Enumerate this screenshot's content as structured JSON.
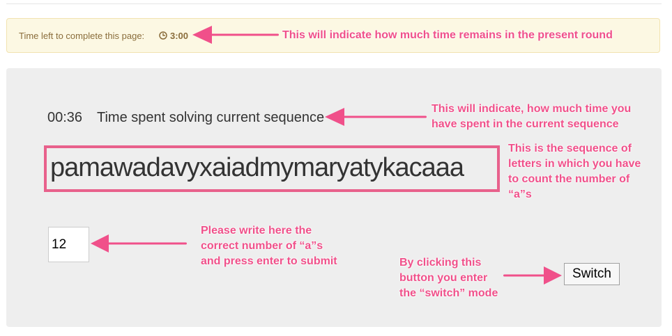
{
  "timer_banner": {
    "label": "Time left to complete this page:",
    "icon": "clock-icon",
    "value": "3:00"
  },
  "sequence_panel": {
    "elapsed_time": "00:36",
    "elapsed_label": "Time spent solving current sequence",
    "sequence": "pamawadavyxaiadmymaryatykacaaa",
    "count_input_value": "12",
    "switch_label": "Switch"
  },
  "annotations": {
    "time_remaining": [
      "This will indicate how much time  remains in the present round"
    ],
    "time_spent": [
      "This will indicate, how much time you",
      "have spent in the current sequence"
    ],
    "sequence": [
      "This is the sequence of",
      "letters in which you have",
      "to count the number of",
      "“a”s"
    ],
    "input": [
      "Please write here the",
      "correct number of “a”s",
      "and press enter to submit"
    ],
    "switch": [
      "By clicking this",
      "button you enter",
      "the “switch” mode"
    ]
  },
  "colors": {
    "annotation": "#f0508a",
    "banner_background": "#fcf8e3",
    "banner_text": "#8a6d3b",
    "panel_background": "#eeeeee"
  }
}
